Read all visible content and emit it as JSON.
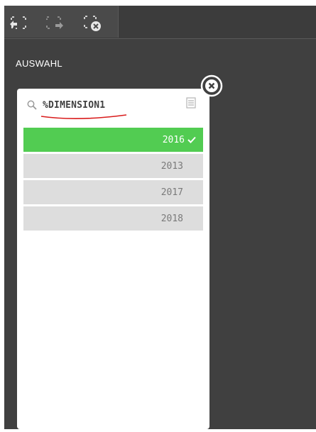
{
  "toolbar": {
    "icons": [
      "step-back-icon",
      "step-forward-icon",
      "clear-selections-icon"
    ]
  },
  "section": {
    "label": "AUSWAHL"
  },
  "filter": {
    "search_value": "%DIMENSION1",
    "items": [
      {
        "label": "2016",
        "selected": true
      },
      {
        "label": "2013",
        "selected": false
      },
      {
        "label": "2017",
        "selected": false
      },
      {
        "label": "2018",
        "selected": false
      }
    ]
  },
  "colors": {
    "selected": "#52cc52",
    "possible": "#dddddd",
    "background": "#404040",
    "annotation": "#d91c1c"
  }
}
